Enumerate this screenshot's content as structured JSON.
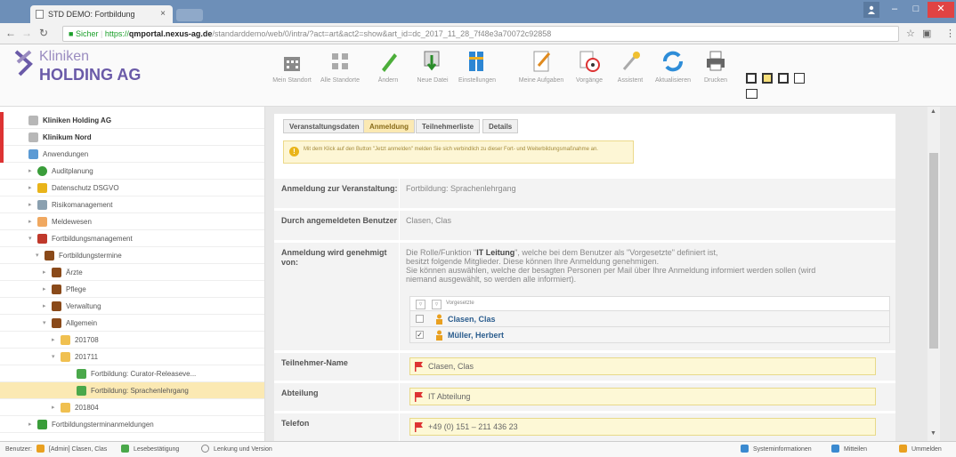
{
  "browser": {
    "tab_title": "STD DEMO: Fortbildung",
    "tab_close": "×",
    "url_secure_label": "Sicher",
    "url_scheme": "https://",
    "url_host": "qmportal.nexus-ag.de",
    "url_path": "/standarddemo/web/0/intra/?act=art&act2=show&art_id=dc_2017_11_28_7f48e3a70072c92858"
  },
  "logo": {
    "line1": "Kliniken",
    "line2": "HOLDING AG"
  },
  "toolbar": [
    {
      "label": "Mein Standort",
      "icon": "building-icon"
    },
    {
      "label": "Alle Standorte",
      "icon": "sites-icon"
    },
    {
      "label": "Ändern",
      "icon": "pencil-icon"
    },
    {
      "label": "Neue Datei",
      "icon": "new-file-icon"
    },
    {
      "label": "Einstellungen",
      "icon": "settings-icon"
    },
    {
      "label": "Meine Aufgaben",
      "icon": "tasks-icon"
    },
    {
      "label": "Vorgänge",
      "icon": "processes-icon"
    },
    {
      "label": "Assistent",
      "icon": "wand-icon"
    },
    {
      "label": "Aktualisieren",
      "icon": "refresh-icon"
    },
    {
      "label": "Drucken",
      "icon": "print-icon"
    }
  ],
  "sidebar": {
    "items": [
      {
        "label": "Kliniken Holding AG",
        "bold": true,
        "icon": "hospital-icon"
      },
      {
        "label": "Klinikum Nord",
        "bold": true,
        "icon": "hospital-icon"
      },
      {
        "label": "Anwendungen",
        "icon": "monitor-icon"
      },
      {
        "label": "Auditplanung",
        "icon": "audit-icon"
      },
      {
        "label": "Datenschutz DSGVO",
        "icon": "shield-icon"
      },
      {
        "label": "Risikomanagement",
        "icon": "risk-icon"
      },
      {
        "label": "Meldewesen",
        "icon": "report-icon"
      },
      {
        "label": "Fortbildungsmanagement",
        "icon": "training-icon"
      },
      {
        "label": "Fortbildungstermine",
        "icon": "chart-icon"
      },
      {
        "label": "Ärzte",
        "icon": "chart-icon"
      },
      {
        "label": "Pflege",
        "icon": "chart-icon"
      },
      {
        "label": "Verwaltung",
        "icon": "chart-icon"
      },
      {
        "label": "Allgemein",
        "icon": "chart-icon"
      },
      {
        "label": "201708",
        "icon": "folder-icon"
      },
      {
        "label": "201711",
        "icon": "folder-icon"
      },
      {
        "label": "Fortbildung: Curator-Releaseve...",
        "icon": "doc-icon"
      },
      {
        "label": "Fortbildung: Sprachenlehrgang",
        "icon": "doc-icon"
      },
      {
        "label": "201804",
        "icon": "folder-icon"
      },
      {
        "label": "Fortbildungsterminanmeldungen",
        "icon": "calendar-icon"
      }
    ]
  },
  "tabs": [
    {
      "label": "Veranstaltungsdaten"
    },
    {
      "label": "Anmeldung",
      "active": true
    },
    {
      "label": "Teilnehmerliste"
    },
    {
      "label": "Details"
    }
  ],
  "note": "Mit dem Klick auf den Button \"Jetzt anmelden\" melden Sie sich verbindlich zu dieser Fort- und Weiterbildungsmaßnahme an.",
  "fields": {
    "event_label": "Anmeldung zur Veranstaltung:",
    "event_value": "Fortbildung: Sprachenlehrgang",
    "by_label": "Durch angemeldeten Benutzer",
    "by_value": "Clasen, Clas",
    "approval_label": "Anmeldung wird genehmigt von:",
    "approval_text_1a": "Die Rolle/Funktion \"",
    "approval_role": "IT Leitung",
    "approval_text_1b": "\", welche bei dem Benutzer als \"Vorgesetzte\" definiert ist,",
    "approval_text_2": "besitzt folgende Mitglieder. Diese können Ihre Anmeldung genehmigen.",
    "approval_text_3": "Sie können auswählen, welche der besagten Personen per Mail über Ihre Anmeldung informiert werden sollen (wird",
    "approval_text_4": "niemand ausgewählt, so werden alle informiert).",
    "grid_column": "Vorgesetzte",
    "approvers": [
      {
        "name": "Clasen, Clas",
        "checked": false
      },
      {
        "name": "Müller, Herbert",
        "checked": true
      }
    ],
    "participant_label": "Teilnehmer-Name",
    "participant_value": "Clasen, Clas",
    "department_label": "Abteilung",
    "department_value": "IT Abteilung",
    "phone_label": "Telefon",
    "phone_value": "+49 (0) 151 – 211 436 23"
  },
  "status": {
    "user_prefix": "Benutzer:",
    "user": "[Admin] Clasen, Clas",
    "read": "Lesebestätigung",
    "history": "Lenkung und Version",
    "sysinfo": "Systeminformationen",
    "messages": "Mitteilen",
    "logout": "Ummelden"
  },
  "colors": {
    "brand": "#6a5aa8",
    "highlight": "#fbe9b3",
    "titlebar": "#6d8fb8",
    "close": "#e04343"
  }
}
